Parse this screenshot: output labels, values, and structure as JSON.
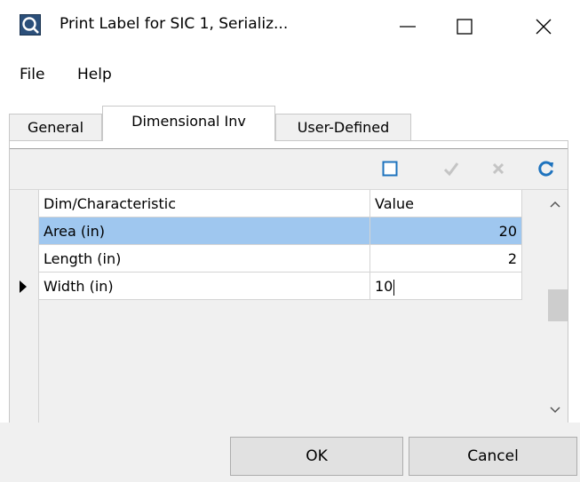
{
  "window": {
    "title": "Print Label for SIC 1, Serializ...",
    "app_icon": "app-logo-icon",
    "controls": [
      "minimize-icon",
      "maximize-icon",
      "close-icon"
    ]
  },
  "menu": {
    "items": [
      {
        "label": "File"
      },
      {
        "label": "Help"
      }
    ]
  },
  "tabs": [
    {
      "label": "General",
      "active": false
    },
    {
      "label": "Dimensional Inv",
      "active": true
    },
    {
      "label": "User-Defined",
      "active": false
    }
  ],
  "toolbar": {
    "icons": [
      "new-record-icon",
      "checkmark-icon",
      "cancel-x-icon",
      "refresh-icon"
    ],
    "accent": "#1e73be"
  },
  "grid": {
    "columns": [
      "Dim/Characteristic",
      "Value"
    ],
    "rows": [
      {
        "name": "Area (in)",
        "value": "20",
        "selected": true
      },
      {
        "name": "Length (in)",
        "value": "2",
        "selected": false
      },
      {
        "name": "Width (in)",
        "value": "10",
        "selected": false,
        "editing": true
      }
    ],
    "selected_row_color": "#9fc7ef"
  },
  "buttons": {
    "ok": "OK",
    "cancel": "Cancel"
  }
}
